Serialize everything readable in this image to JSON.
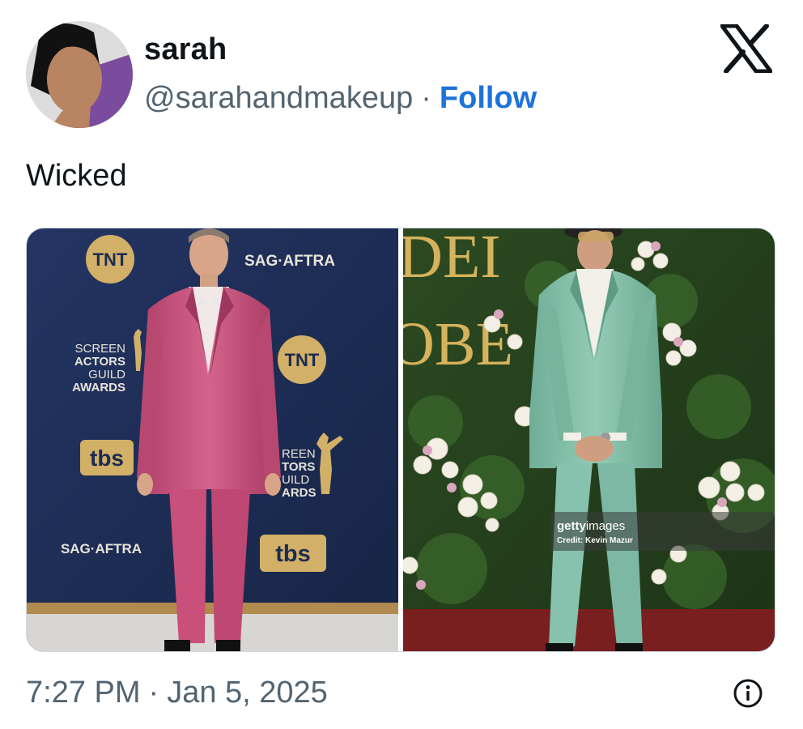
{
  "author": {
    "name": "sarah",
    "handle": "@sarahandmakeup",
    "separator": "·",
    "follow_label": "Follow"
  },
  "tweet": {
    "text": "Wicked"
  },
  "media": {
    "left_photo": {
      "backdrop_texts": [
        "SCREEN",
        "ACTORS",
        "GUILD",
        "AWARDS",
        "SAG·AFTRA",
        "TNT",
        "tbs",
        "REEN",
        "TORS",
        "UILD",
        "ARDS"
      ]
    },
    "right_photo": {
      "backdrop_texts": [
        "DEI",
        "OBE"
      ],
      "watermark_brand_bold": "getty",
      "watermark_brand_light": "images",
      "watermark_credit": "Credit: Kevin Mazur"
    }
  },
  "footer": {
    "time": "7:27 PM",
    "separator": "·",
    "date": "Jan 5, 2025"
  },
  "icons": {
    "brand_logo": "x-logo-icon",
    "info": "info-icon"
  },
  "colors": {
    "follow_link": "#1d73d8",
    "secondary_text": "#536471",
    "pink_suit": "#c8507a",
    "green_suit": "#86c2ad",
    "sag_backdrop": "#1c2b53"
  }
}
